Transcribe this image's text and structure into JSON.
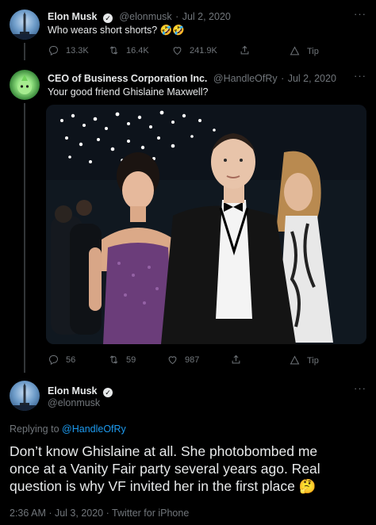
{
  "tweet1": {
    "name": "Elon Musk",
    "handle": "@elonmusk",
    "date": "Jul 2, 2020",
    "text": "Who wears short shorts? 🤣🤣",
    "replies": "13.3K",
    "retweets": "16.4K",
    "likes": "241.9K",
    "tip": "Tip"
  },
  "tweet2": {
    "name": "CEO of Business Corporation Inc.",
    "handle": "@HandleOfRy",
    "date": "Jul 2, 2020",
    "text": "Your good friend Ghislaine Maxwell?",
    "replies": "56",
    "retweets": "59",
    "likes": "987",
    "tip": "Tip"
  },
  "tweet3": {
    "name": "Elon Musk",
    "handle": "@elonmusk",
    "replying_label": "Replying to",
    "replying_to": "@HandleOfRy",
    "text_line1": "Don’t know Ghislaine at all. She photobombed me",
    "text_line2": "once at a Vanity Fair party several years ago. Real",
    "text_line3": "question is why VF invited her in the first place 🤔",
    "timestamp": "2:36 AM · Jul 3, 2020 · Twitter for iPhone"
  },
  "separator": "·",
  "more": "···",
  "icons": [
    "reply-icon",
    "retweet-icon",
    "like-icon",
    "share-icon",
    "tip-icon",
    "verified-icon",
    "more-icon"
  ]
}
